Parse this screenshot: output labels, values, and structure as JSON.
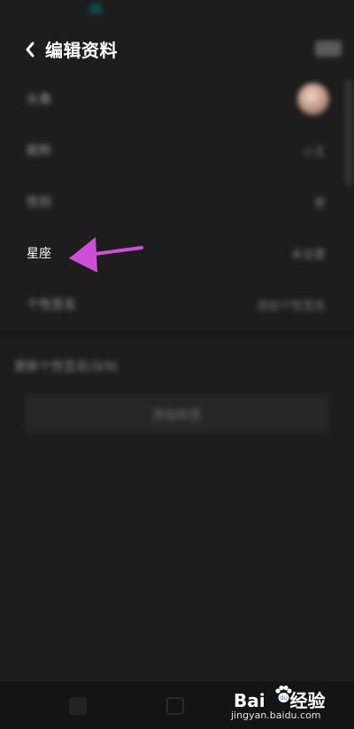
{
  "header": {
    "title": "编辑资料",
    "save_label": "保存"
  },
  "rows": [
    {
      "label": "头像",
      "value": ""
    },
    {
      "label": "昵称",
      "value": "小王"
    },
    {
      "label": "性别",
      "value": "男"
    },
    {
      "label": "星座",
      "value": "未设置"
    },
    {
      "label": "个性签名",
      "value": "添加个性签名"
    }
  ],
  "section": {
    "title": "更新个性签名(9/9)",
    "button_label": "添加标签"
  },
  "annotation": {
    "color": "#cc4fd6",
    "points_to": "星座"
  },
  "watermark": {
    "logo_prefix": "Bai",
    "logo_suffix": "经验",
    "url": "jingyan.baidu.com"
  }
}
